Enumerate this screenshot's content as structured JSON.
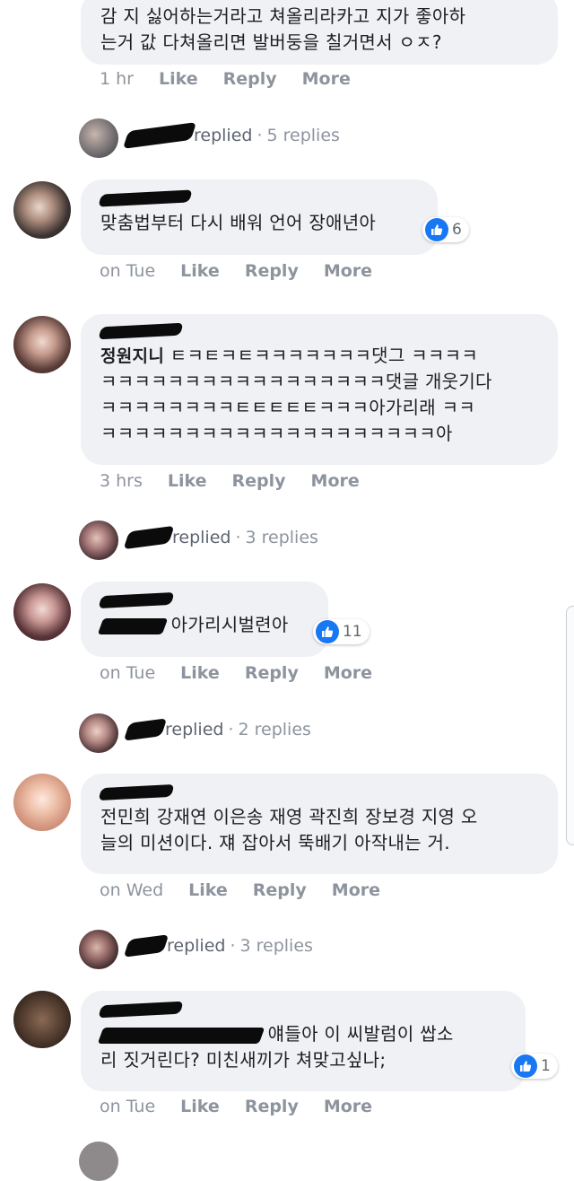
{
  "comments": [
    {
      "text": "감 지 싫어하는거라고 쳐올리라카고 지가 좋아하\n는거 값 다쳐올리면 발버둥을 칠거면서 ㅇㅈ?",
      "time": "1 hr",
      "like": "Like",
      "reply": "Reply",
      "more": "More"
    },
    {
      "author": "",
      "text": "맞춤법부터 다시 배워 언어 장애년아",
      "reactions": "6",
      "time": "on Tue",
      "like": "Like",
      "reply": "Reply",
      "more": "More"
    },
    {
      "author": "정원지니",
      "text": " ㅌㅋㅌㅋㅌㅋㅋㅋㅋㅋㅋㅋ댓그 ㅋㅋㅋㅋ\nㅋㅋㅋㅋㅋㅋㅋㅋㅋㅋㅋㅋㅋㅋㅋㅋㅋ댓글 개웃기다\nㅋㅋㅋㅋㅋㅋㅋㅋㅌㅌㅌㅌㅌㅋㅋㅋ아가리래 ㅋㅋ\nㅋㅋㅋㅋㅋㅋㅋㅋㅋㅋㅋㅋㅋㅋㅋㅋㅋㅋㅋㅋ아",
      "time": "3 hrs",
      "like": "Like",
      "reply": "Reply",
      "more": "More"
    },
    {
      "author": "",
      "text": "아가리시벌련아",
      "reactions": "11",
      "time": "on Tue",
      "like": "Like",
      "reply": "Reply",
      "more": "More"
    },
    {
      "author": "",
      "text": "전민희 강재연 이은송 재영 곽진희 장보경 지영 오\n늘의 미션이다. 쟤 잡아서 뚝배기 아작내는 거.",
      "time": "on Wed",
      "like": "Like",
      "reply": "Reply",
      "more": "More"
    },
    {
      "author": "",
      "text_line1": "얘들아 이 씨발럼이 쌉소",
      "text_line2": "리 짓거린다? 미친새끼가 쳐맞고싶나;",
      "reactions": "1",
      "time": "on Tue",
      "like": "Like",
      "reply": "Reply",
      "more": "More"
    }
  ],
  "reply_threads": [
    {
      "replied": "replied",
      "count": "5 replies"
    },
    {
      "replied": "replied",
      "count": "3 replies"
    },
    {
      "replied": "replied",
      "count": "2 replies"
    },
    {
      "replied": "replied",
      "count": "3 replies"
    }
  ],
  "colors": {
    "bubble": "#f0f1f5",
    "meta": "#8d949e",
    "like_blue": "#1877f2",
    "text": "#1c1e21"
  }
}
